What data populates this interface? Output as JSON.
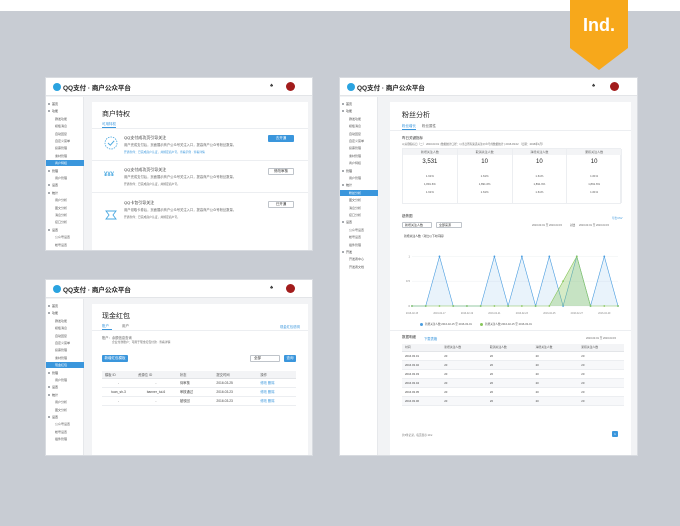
{
  "badge": {
    "label": "Ind.",
    "color": "#f7a81b"
  },
  "app": {
    "brand": "QQ支付 · 商户公众平台",
    "bell": "♠",
    "accent": "#3a96dc",
    "avatar_color": "#a21c1c"
  },
  "sidebar1": [
    "首页",
    "功能",
    "群发功能",
    "模板消息",
    "自动回复",
    "自定义菜单",
    "投票管理",
    "素材管理",
    "商户特权",
    "管理",
    "用户管理",
    "设置",
    "统计",
    "用户分析",
    "图文分析",
    "消息分析",
    "接口分析",
    "设置",
    "公众号设置",
    "帐号设置",
    "插件管理"
  ],
  "sidebar2": [
    "首页",
    "功能",
    "群发功能",
    "模板消息",
    "自动回复",
    "自定义菜单",
    "投票管理",
    "素材管理",
    "现金红包",
    "管理",
    "用户管理",
    "设置",
    "统计",
    "用户分析",
    "图文分析",
    "设置",
    "公众号设置",
    "帐号设置",
    "插件管理"
  ],
  "sidebar3": [
    "首页",
    "功能",
    "群发功能",
    "模板消息",
    "自动回复",
    "自定义菜单",
    "投票管理",
    "素材管理",
    "商户特权",
    "管理",
    "用户管理",
    "统计",
    "粉丝分析",
    "图文分析",
    "消息分析",
    "接口分析",
    "设置",
    "公众号设置",
    "帐号设置",
    "插件管理",
    "开发",
    "开发者中心",
    "开发者文档"
  ],
  "privilege": {
    "title": "商户特权",
    "tab": "可用特权",
    "items": [
      {
        "name": "QQ支付成功页引导关注",
        "desc": "用户完成支付后，页面展示商户公众号关注入口，提高商户公众号粉丝数量。",
        "desc2": "开通条件：已完成商户认证，并绑定商户号。查看示例 · 查看详情",
        "button": "去开通"
      },
      {
        "name": "QQ支付成功页引导关注",
        "desc": "用户完成支付后，页面展示商户公众号关注入口，提高商户公众号粉丝数量。",
        "desc2": "开通条件：已完成商户认证，并绑定商户号。",
        "button": "修改审核"
      },
      {
        "name": "QQ卡包引导关注",
        "desc": "用户领取卡券后，页面展示商户公众号关注入口，提高商户公众号粉丝数量。",
        "desc2": "开通条件：已完成商户认证，并绑定商户号。",
        "button": "已开通"
      }
    ]
  },
  "redpacket": {
    "title": "现金红包",
    "tabs": [
      "账户",
      "用户"
    ],
    "top_link": "现金红包说明",
    "info1": "账户：",
    "info2": "余额信息查询",
    "info3": "企业付款账户：可用于现金红包付款 · 查看详情",
    "create_button": "新增红包模板",
    "select_label": "全部",
    "search_button": "查询",
    "columns": [
      "模板 ID",
      "资源位 ID",
      "状态",
      "提交时间",
      "操作"
    ],
    "rows": [
      {
        "tpl": "-",
        "res": "-",
        "status": "待审核",
        "time": "2016.03.25",
        "a1": "修改",
        "a2": "删除"
      },
      {
        "tpl": "tuan_sh-3",
        "res": "banner_tui-6",
        "status": "审核通过",
        "time": "2016.03.23",
        "a1": "修改",
        "a2": "删除"
      },
      {
        "tpl": "-",
        "res": "-",
        "status": "被驳回",
        "time": "2016.03.23",
        "a1": "修改",
        "a2": "删除"
      }
    ]
  },
  "fans": {
    "title": "粉丝分析",
    "tabs": [
      "粉丝增长",
      "粉丝属性"
    ],
    "section1": "昨日关键指标",
    "section1_note": "以关键指标日（二） 2016.03.01 | 数据统计口径：以当日所有渠道关注公众号的数据统计 | 2016.03.02 （日期：2016年1月）",
    "metrics": [
      {
        "label": "新增关注人数",
        "value": "3,531",
        "r1": "1.61%",
        "r2": "1,891.6%",
        "r3": "1.61%"
      },
      {
        "label": "取消关注人数",
        "value": "10",
        "r1": "1.61%",
        "r2": "1,891.6%",
        "r3": "1.61%"
      },
      {
        "label": "净增关注人数",
        "value": "10",
        "r1": "1.61%",
        "r2": "1,891.6%",
        "r3": "1.61%"
      },
      {
        "label": "累积关注人数",
        "value": "10",
        "r1": "1.61%",
        "r2": "1,891.6%",
        "r3": "1.61%"
      }
    ],
    "section2": "趋势图",
    "filter1": "新增关注人数",
    "filter2": "全部来源",
    "date_range": "2016.03.01 至 2016.03.15",
    "compare": "对比",
    "date_range2": "2016.03.01 至 2016.03.15",
    "export": "导出CSV",
    "chart_title": "新增关注人数（对比以下时间段）",
    "chart_data": {
      "type": "line",
      "x": [
        "2016-02-15",
        "2016-02-16",
        "2016-02-17",
        "2016-02-18",
        "2016-02-19",
        "2016-02-20",
        "2016-02-21",
        "2016-02-22",
        "2016-02-23",
        "2016-02-24",
        "2016-02-25",
        "2016-02-26",
        "2016-02-27",
        "2016-02-28",
        "2016-02-29",
        "2016-03-01"
      ],
      "series": [
        {
          "name": "新增关注人数 2016-02-15 至 2016-03-01",
          "color": "#4a9de0",
          "values": [
            0,
            0,
            1,
            0,
            0,
            0,
            1,
            0,
            1,
            0,
            1,
            0,
            1,
            0,
            1,
            0
          ]
        },
        {
          "name": "新增关注人数 2016-02-15 至 2016-03-01",
          "color": "#88c65b",
          "values": [
            0,
            0,
            0,
            0,
            0,
            0,
            0,
            0,
            0,
            0,
            0,
            0.5,
            1,
            0,
            0,
            0
          ]
        }
      ],
      "yticks": [
        "0",
        "0.5",
        "1"
      ],
      "ylim": [
        0,
        1.25
      ]
    },
    "section3": "数据明细",
    "section3_link": "下载表格",
    "table_date": "2016.03.01 至 2016.03.15",
    "table_columns": [
      "时间",
      "新增关注人数",
      "取消关注人数",
      "净增关注人数",
      "累积关注人数"
    ],
    "table_rows": [
      [
        "2016.03.01",
        "20",
        "20",
        "20",
        "20"
      ],
      [
        "2016.03.02",
        "20",
        "20",
        "20",
        "20"
      ],
      [
        "2016.03.03",
        "20",
        "20",
        "20",
        "20"
      ],
      [
        "2016.03.04",
        "20",
        "20",
        "20",
        "20"
      ],
      [
        "2016.03.05",
        "20",
        "20",
        "20",
        "20"
      ],
      [
        "2016.03.06",
        "20",
        "20",
        "20",
        "20"
      ]
    ],
    "footer": "共5条记录，每页显示 10 ▾",
    "page": "1"
  }
}
